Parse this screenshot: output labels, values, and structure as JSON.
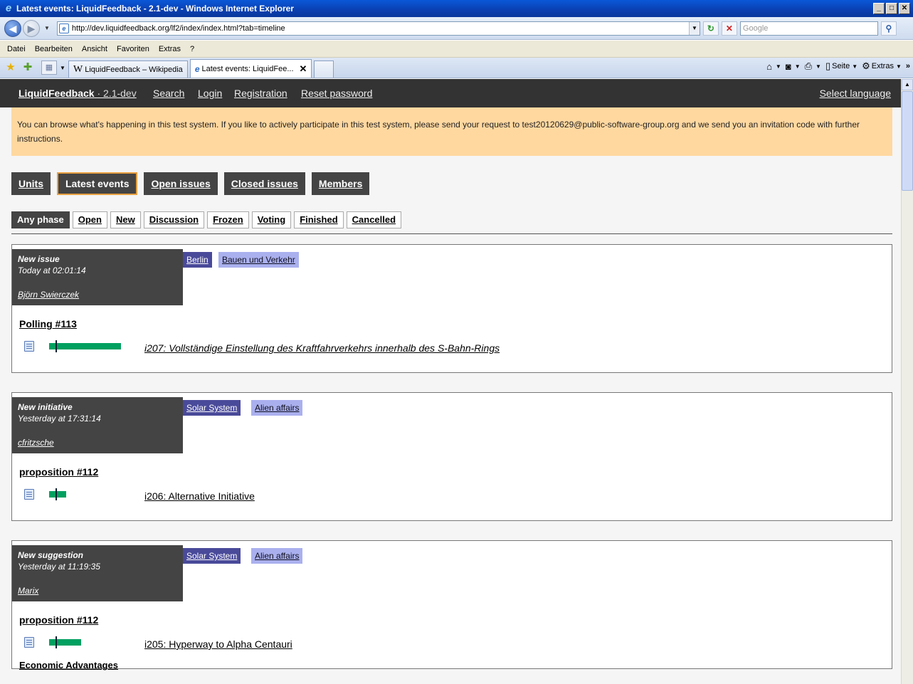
{
  "window": {
    "title": "Latest events: LiquidFeedback - 2.1-dev - Windows Internet Explorer",
    "address": "http://dev.liquidfeedback.org/lf2/index/index.html?tab=timeline",
    "search_placeholder": "Google",
    "menu": [
      "Datei",
      "Bearbeiten",
      "Ansicht",
      "Favoriten",
      "Extras",
      "?"
    ],
    "tabs": [
      {
        "label": "LiquidFeedback – Wikipedia",
        "icon": "wikipedia-icon"
      },
      {
        "label": "Latest events: LiquidFee...",
        "icon": "ie-page-icon"
      }
    ],
    "toolbar_right": {
      "page_label": "Seite",
      "extras_label": "Extras"
    }
  },
  "header": {
    "brand": "LiquidFeedback",
    "version": "· 2.1-dev",
    "links": [
      "Search",
      "Login",
      "Registration",
      "Reset password"
    ],
    "language": "Select language"
  },
  "notice": "You can browse what's happening in this test system. If you like to actively participate in this test system, please send your request to test20120629@public-software-group.org and we send you an invitation code with further instructions.",
  "main_nav": [
    {
      "label": "Units",
      "active": false
    },
    {
      "label": "Latest events",
      "active": true
    },
    {
      "label": "Open issues",
      "active": false
    },
    {
      "label": "Closed issues",
      "active": false
    },
    {
      "label": "Members",
      "active": false
    }
  ],
  "filters": [
    {
      "label": "Any phase",
      "active": true
    },
    {
      "label": "Open",
      "active": false
    },
    {
      "label": "New",
      "active": false
    },
    {
      "label": "Discussion",
      "active": false
    },
    {
      "label": "Frozen",
      "active": false
    },
    {
      "label": "Voting",
      "active": false
    },
    {
      "label": "Finished",
      "active": false
    },
    {
      "label": "Cancelled",
      "active": false
    }
  ],
  "events": [
    {
      "type": "New issue",
      "time": "Today at 02:01:14",
      "author": "Björn Swierczek",
      "unit": "Berlin",
      "area": "Bauen und Verkehr",
      "issue": "Polling #113",
      "support_fraction": 1.0,
      "initiative": "i207: Vollständige Einstellung des Kraftfahrverkehrs innerhalb des S-Bahn-Rings",
      "initiative_italic": true,
      "suggestion": ""
    },
    {
      "type": "New initiative",
      "time": "Yesterday at 17:31:14",
      "author": "cfritzsche",
      "unit": "Solar System",
      "area": "Alien affairs",
      "issue": "proposition #112",
      "support_fraction": 0.24,
      "initiative": "i206: Alternative Initiative",
      "initiative_italic": false,
      "suggestion": ""
    },
    {
      "type": "New suggestion",
      "time": "Yesterday at 11:19:35",
      "author": "Marix",
      "unit": "Solar System",
      "area": "Alien affairs",
      "issue": "proposition #112",
      "support_fraction": 0.45,
      "initiative": "i205: Hyperway to Alpha Centauri",
      "initiative_italic": false,
      "suggestion": "Economic Advantages"
    }
  ],
  "colors": {
    "header_bg": "#333333",
    "notice_bg": "#ffd8a0",
    "unit_bg": "#4a4a9a",
    "area_bg": "#aab0ee",
    "support_bar": "#00a060",
    "active_outline": "#e8a040"
  }
}
